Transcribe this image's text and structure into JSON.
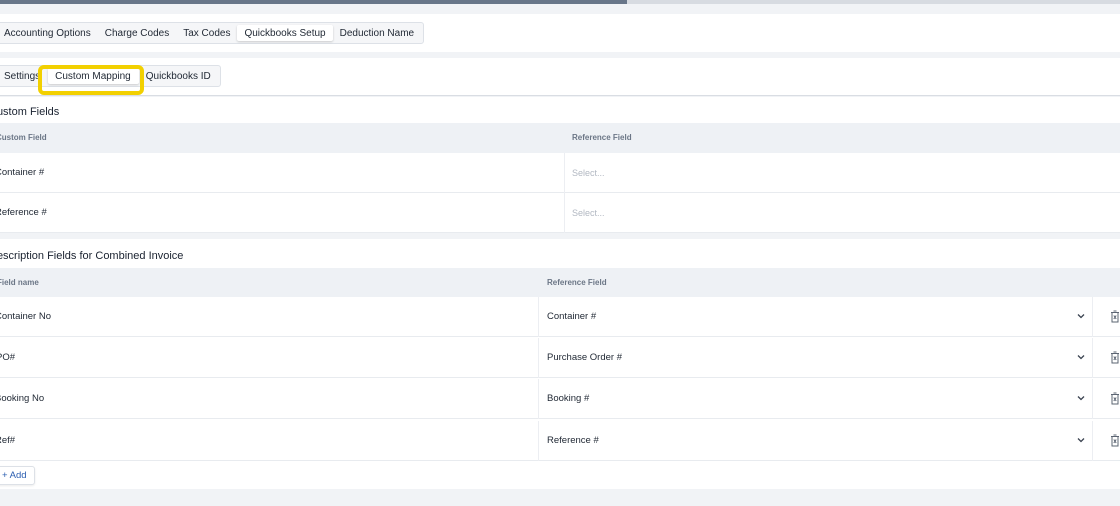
{
  "progress": 0.56,
  "main_tabs": [
    {
      "label": "Accounting Options",
      "active": false
    },
    {
      "label": "Charge Codes",
      "active": false
    },
    {
      "label": "Tax Codes",
      "active": false
    },
    {
      "label": "Quickbooks Setup",
      "active": true
    },
    {
      "label": "Deduction Name",
      "active": false
    }
  ],
  "sub_tabs": [
    {
      "label": "Settings",
      "active": false
    },
    {
      "label": "Custom Mapping",
      "active": true
    },
    {
      "label": "Quickbooks ID",
      "active": false
    }
  ],
  "custom_fields": {
    "title": "Custom Fields",
    "headers": {
      "col1": "Custom Field",
      "col2": "Reference Field"
    },
    "rows": [
      {
        "field": "Container #",
        "placeholder": "Select..."
      },
      {
        "field": "Reference #",
        "placeholder": "Select..."
      }
    ]
  },
  "description_fields": {
    "title": "Description Fields for Combined Invoice",
    "headers": {
      "col1": "Field name",
      "col2": "Reference Field"
    },
    "rows": [
      {
        "field": "Container No",
        "reference": "Container #"
      },
      {
        "field": "PO#",
        "reference": "Purchase Order #"
      },
      {
        "field": "Booking No",
        "reference": "Booking #"
      },
      {
        "field": "Ref#",
        "reference": "Reference #"
      }
    ],
    "add_label": "+ Add"
  },
  "icons": {
    "dropdown": "chevron-down-icon",
    "delete": "trash-icon"
  },
  "colors": {
    "highlight": "#f2d000",
    "link": "#2a5db0",
    "progress": "#687689"
  }
}
